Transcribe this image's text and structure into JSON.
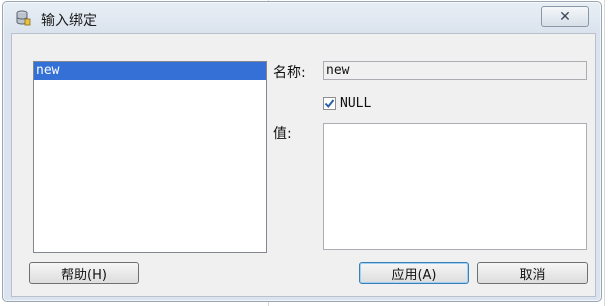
{
  "window": {
    "title": "输入绑定",
    "close_glyph": "✕"
  },
  "bindings_list": {
    "items": [
      {
        "label": "new",
        "selected": true
      }
    ]
  },
  "form": {
    "name_label": "名称:",
    "name_value": "new",
    "null_checkbox": {
      "label": "NULL",
      "checked": true
    },
    "value_label": "值:",
    "value_text": ""
  },
  "buttons": {
    "help": "帮助(H)",
    "apply": "应用(A)",
    "cancel": "取消"
  },
  "colors": {
    "selection": "#3470d6",
    "title_bar": "#dbe4ee",
    "dialog_body": "#f0f0f0"
  }
}
